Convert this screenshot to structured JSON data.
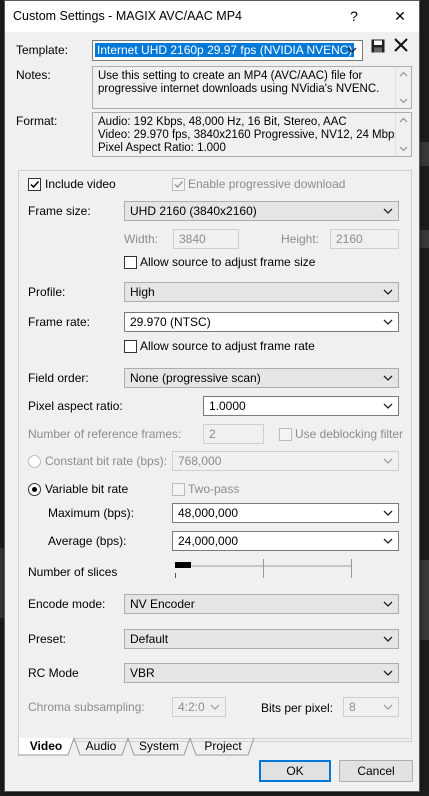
{
  "window": {
    "title": "Custom Settings - MAGIX AVC/AAC MP4",
    "help": "?",
    "close": "✕"
  },
  "template": {
    "label": "Template:",
    "value": "Internet UHD 2160p 29.97 fps (NVIDIA NVENC)"
  },
  "notes": {
    "label": "Notes:",
    "line1": "Use this setting to create an MP4 (AVC/AAC) file for",
    "line2": "progressive internet downloads using NVidia's NVENC."
  },
  "format": {
    "label": "Format:",
    "line1": "Audio: 192 Kbps, 48,000 Hz, 16 Bit, Stereo, AAC",
    "line2": "Video: 29.970 fps, 3840x2160 Progressive, NV12, 24 Mbps",
    "line3": "Pixel Aspect Ratio: 1.000"
  },
  "video": {
    "include_video": "Include video",
    "include_video_checked": true,
    "progressive_download": "Enable progressive download",
    "progressive_download_checked": true,
    "frame_size_label": "Frame size:",
    "frame_size": "UHD 2160 (3840x2160)",
    "width_label": "Width:",
    "width": "3840",
    "height_label": "Height:",
    "height": "2160",
    "allow_frame_size": "Allow source to adjust frame size",
    "profile_label": "Profile:",
    "profile": "High",
    "frame_rate_label": "Frame rate:",
    "frame_rate": "29.970 (NTSC)",
    "allow_frame_rate": "Allow source to adjust frame rate",
    "field_order_label": "Field order:",
    "field_order": "None (progressive scan)",
    "par_label": "Pixel aspect ratio:",
    "par": "1.0000",
    "ref_frames_label": "Number of reference frames:",
    "ref_frames": "2",
    "deblocking": "Use deblocking filter",
    "cbr_label": "Constant bit rate (bps):",
    "cbr": "768,000",
    "vbr_label": "Variable bit rate",
    "two_pass": "Two-pass",
    "max_label": "Maximum (bps):",
    "max": "48,000,000",
    "avg_label": "Average (bps):",
    "avg": "24,000,000",
    "slices_label": "Number of slices",
    "slices_level": 0,
    "encode_mode_label": "Encode mode:",
    "encode_mode": "NV Encoder",
    "preset_label": "Preset:",
    "preset": "Default",
    "rc_mode_label": "RC Mode",
    "rc_mode": "VBR",
    "chroma_label": "Chroma subsampling:",
    "chroma": "4:2:0",
    "bpp_label": "Bits per pixel:",
    "bpp": "8"
  },
  "tabs": [
    "Video",
    "Audio",
    "System",
    "Project"
  ],
  "buttons": {
    "ok": "OK",
    "cancel": "Cancel"
  },
  "colors": {
    "selection": "#0078d7",
    "default_button_border": "#0078d7"
  }
}
